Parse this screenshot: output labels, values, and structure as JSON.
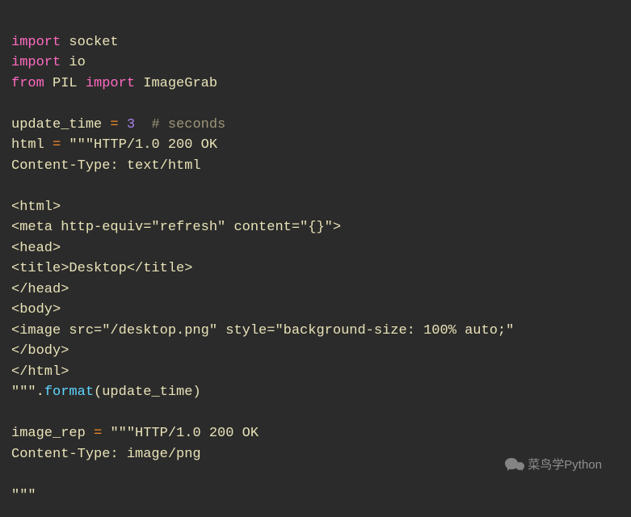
{
  "code": {
    "l1": {
      "kw": "import",
      "mod": "socket"
    },
    "l2": {
      "kw": "import",
      "mod": "io"
    },
    "l3": {
      "kw1": "from",
      "mod": "PIL",
      "kw2": "import",
      "name": "ImageGrab"
    },
    "l5": {
      "var": "update_time",
      "eq": "=",
      "val": "3",
      "comment": "# seconds"
    },
    "l6": {
      "var": "html",
      "eq": "=",
      "part": "\"\"\"HTTP/1.0 200 OK"
    },
    "l7": "Content-Type: text/html",
    "l9": "<html>",
    "l10": "<meta http-equiv=\"refresh\" content=\"{}\">",
    "l11": "<head>",
    "l12": "<title>Desktop</title>",
    "l13": "</head>",
    "l14": "<body>",
    "l15": "<image src=\"/desktop.png\" style=\"background-size: 100% auto;\"",
    "l16": "</body>",
    "l17": "</html>",
    "l18": {
      "end": "\"\"\"",
      "dot": ".",
      "method": "format",
      "open": "(",
      "arg": "update_time",
      "close": ")"
    },
    "l20": {
      "var": "image_rep",
      "eq": "=",
      "part": "\"\"\"HTTP/1.0 200 OK"
    },
    "l21": "Content-Type: image/png",
    "l23": "\"\"\""
  },
  "watermark": "菜鸟学Python"
}
